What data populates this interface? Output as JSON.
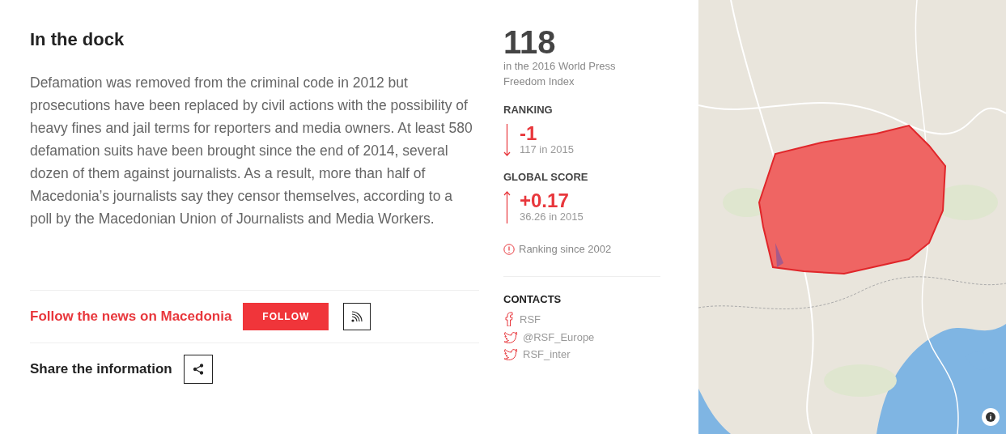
{
  "article": {
    "title": "In the dock",
    "body": "Defamation was removed from the criminal code in 2012 but prosecutions have been replaced by civil actions with the possibility of heavy fines and jail terms for reporters and media owners. At least 580 defamation suits have been brought since the end of 2014, several dozen of them against journalists. As a result, more than half of Macedonia’s journalists say they censor themselves, according to a poll by the Macedonian Union of Journalists and Media Workers."
  },
  "follow": {
    "label": "Follow the news on Macedonia",
    "button": "FOLLOW"
  },
  "share": {
    "label": "Share the information"
  },
  "index": {
    "rank": "118",
    "caption": "in the 2016 World Press Freedom Index"
  },
  "stats": [
    {
      "heading": "RANKING",
      "rising": false,
      "change": "-1",
      "previous": "117 in 2015"
    },
    {
      "heading": "GLOBAL SCORE",
      "rising": true,
      "change": "+0.17",
      "previous": "36.26 in 2015"
    }
  ],
  "history_link": "Ranking since 2002",
  "contacts": {
    "heading": "CONTACTS",
    "items": [
      {
        "kind": "facebook",
        "label": "RSF"
      },
      {
        "kind": "twitter",
        "label": "@RSF_Europe"
      },
      {
        "kind": "twitter",
        "label": "RSF_inter"
      }
    ]
  }
}
